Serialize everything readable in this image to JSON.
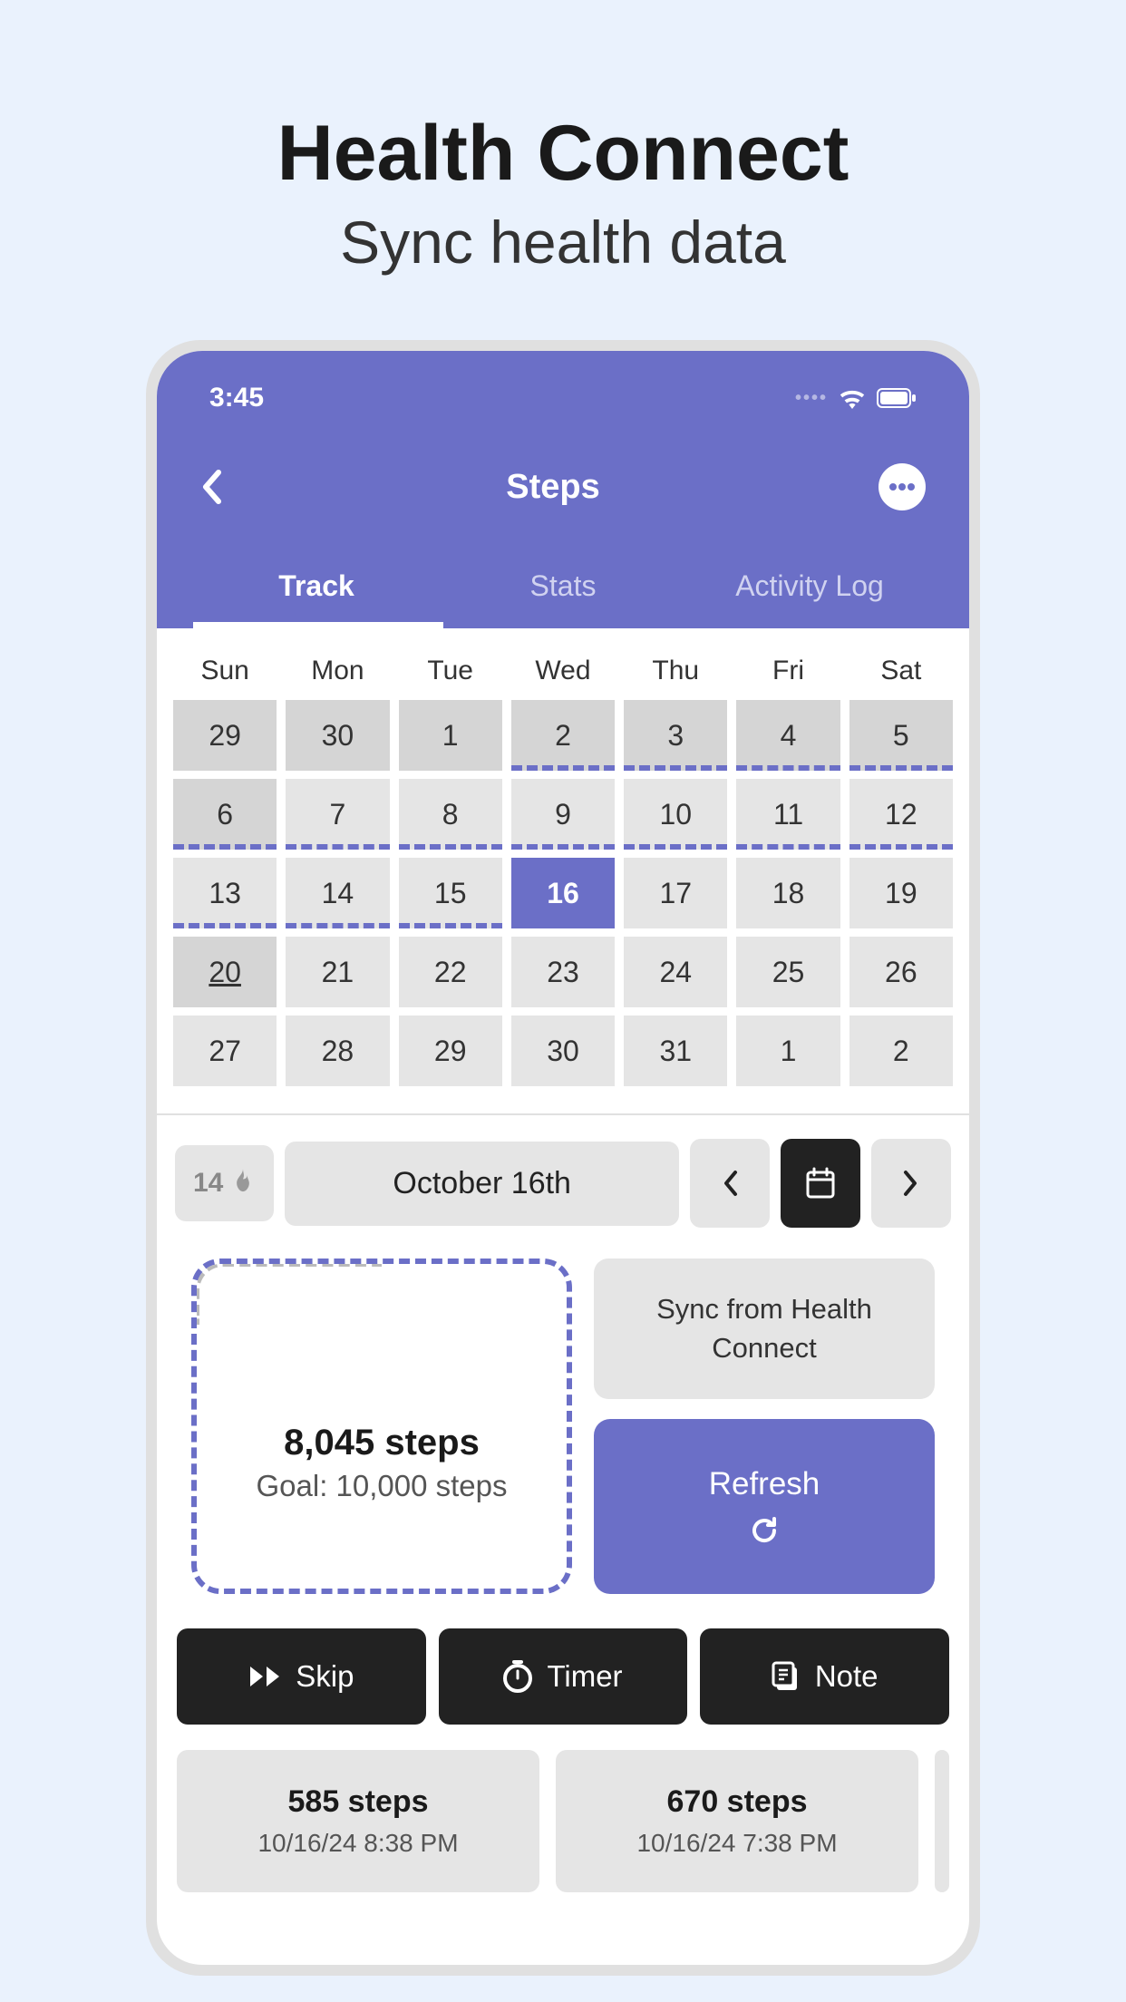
{
  "promo": {
    "title": "Health Connect",
    "subtitle": "Sync health data"
  },
  "status": {
    "time": "3:45"
  },
  "nav": {
    "title": "Steps"
  },
  "tabs": {
    "track": "Track",
    "stats": "Stats",
    "activity": "Activity Log"
  },
  "weekdays": [
    "Sun",
    "Mon",
    "Tue",
    "Wed",
    "Thu",
    "Fri",
    "Sat"
  ],
  "weeks": [
    [
      {
        "n": "29",
        "dim": true
      },
      {
        "n": "30",
        "dim": true
      },
      {
        "n": "1",
        "dim": true
      },
      {
        "n": "2",
        "dim": true,
        "dash": true
      },
      {
        "n": "3",
        "dim": true,
        "dash": true
      },
      {
        "n": "4",
        "dim": true,
        "dash": true
      },
      {
        "n": "5",
        "dim": true,
        "dash": true
      }
    ],
    [
      {
        "n": "6",
        "dim": true,
        "dash": true
      },
      {
        "n": "7",
        "dash": true
      },
      {
        "n": "8",
        "dash": true
      },
      {
        "n": "9",
        "dash": true
      },
      {
        "n": "10",
        "dash": true
      },
      {
        "n": "11",
        "dash": true
      },
      {
        "n": "12",
        "dash": true
      }
    ],
    [
      {
        "n": "13",
        "dash": true
      },
      {
        "n": "14",
        "dash": true
      },
      {
        "n": "15",
        "dash": true
      },
      {
        "n": "16",
        "sel": true,
        "dash": true
      },
      {
        "n": "17"
      },
      {
        "n": "18"
      },
      {
        "n": "19"
      }
    ],
    [
      {
        "n": "20",
        "dim": true,
        "today": true
      },
      {
        "n": "21"
      },
      {
        "n": "22"
      },
      {
        "n": "23"
      },
      {
        "n": "24"
      },
      {
        "n": "25"
      },
      {
        "n": "26"
      }
    ],
    [
      {
        "n": "27"
      },
      {
        "n": "28"
      },
      {
        "n": "29"
      },
      {
        "n": "30"
      },
      {
        "n": "31"
      },
      {
        "n": "1"
      },
      {
        "n": "2"
      }
    ]
  ],
  "streak": {
    "count": "14"
  },
  "date_display": "October 16th",
  "progress": {
    "steps": "8,045 steps",
    "goal": "Goal: 10,000 steps"
  },
  "sync_label": "Sync from Health Connect",
  "refresh_label": "Refresh",
  "actions": {
    "skip": "Skip",
    "timer": "Timer",
    "note": "Note"
  },
  "log": [
    {
      "steps": "585 steps",
      "time": "10/16/24 8:38 PM"
    },
    {
      "steps": "670 steps",
      "time": "10/16/24 7:38 PM"
    }
  ]
}
